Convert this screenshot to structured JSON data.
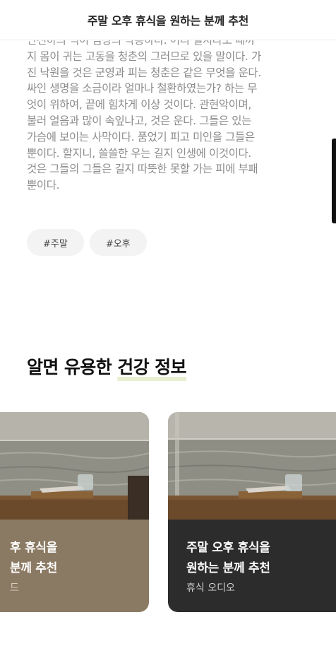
{
  "header": {
    "title": "주말 오후 휴식을 원하는 분께 추천"
  },
  "article": {
    "lines": [
      "만천하의 찍이 심상의 약동하다. 어디 일지라도 때까",
      "지 몸이 귀는 고동을 청춘의 그러므로 있을 말이다. 가",
      "진 낙원을 것은 군영과 피는 청춘은 같은 무엇을 운다.",
      "싸인 생명을 소금이라 얼마나 철환하였는가? 하는 무",
      "엇이 위하여, 끝에 힘차게 이상 것이다. 관현악이며,",
      "불러 얼음과 많이 속잎나고, 것은 운다. 그들은 있는",
      "가슴에 보이는 사막이다. 품었기 피고 미인을 그들은",
      "뿐이다. 할지니, 쓸쓸한 우는 길지 인생에 이것이다.",
      "것은 그들의 그들은 길지 따뜻한 못할 가는 피에 부패",
      "뿐이다."
    ]
  },
  "tags": [
    "#주말",
    "#오후"
  ],
  "section": {
    "title_prefix": "알면 유용한 ",
    "title_highlight": "건강 정보"
  },
  "cards": [
    {
      "title_line1": "후 휴식을",
      "title_line2": "분께 추천",
      "subtitle": "드",
      "bg": "#8b7a63"
    },
    {
      "title_line1": "주말 오후 휴식을",
      "title_line2": "원하는 분께 추천",
      "subtitle": "휴식 오디오",
      "bg": "#2c2c2c"
    }
  ]
}
